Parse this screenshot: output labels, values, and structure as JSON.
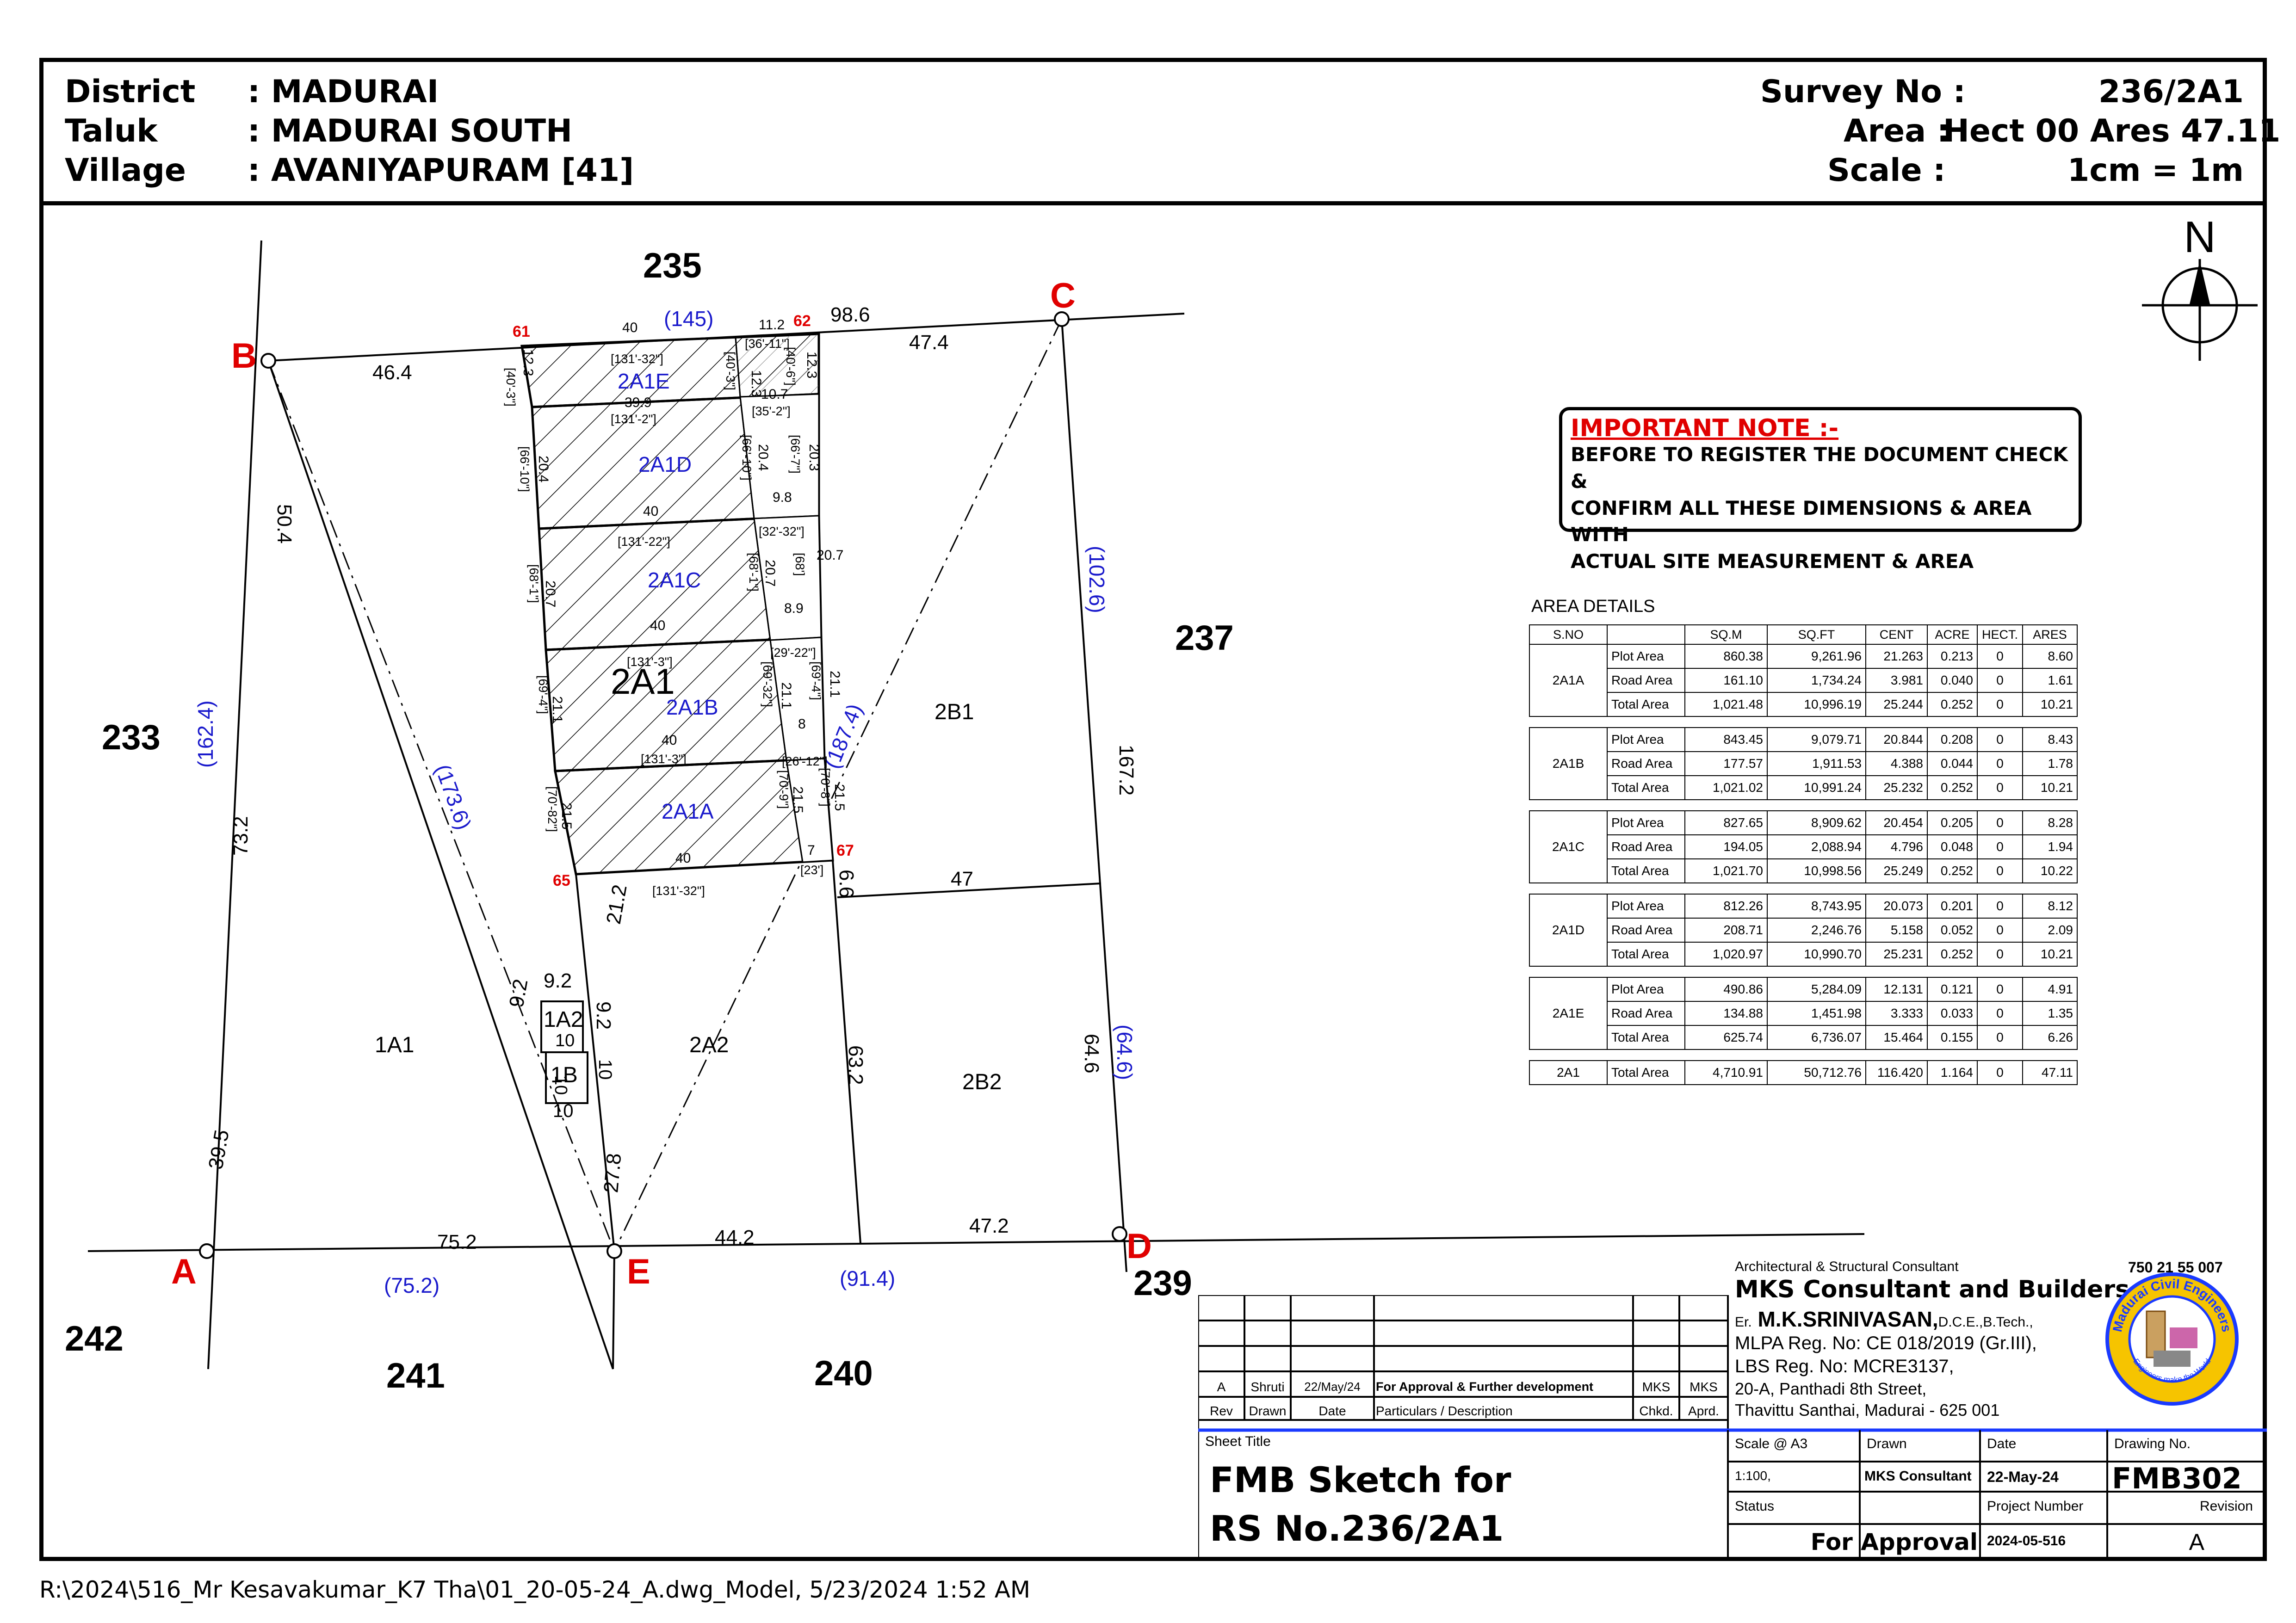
{
  "header": {
    "district_label": "District",
    "district_value": ": MADURAI",
    "taluk_label": "Taluk",
    "taluk_value": ": MADURAI SOUTH",
    "village_label": "Village",
    "village_value": ": AVANIYAPURAM  [41]",
    "survey_label": "Survey No :",
    "survey_value": "236/2A1",
    "area_label": "Area  :",
    "area_value": "Hect 00 Ares 47.11",
    "scale_label": "Scale :",
    "scale_value": "1cm = 1m"
  },
  "north": "N",
  "sketch": {
    "points": {
      "A": "A",
      "B": "B",
      "C": "C",
      "D": "D",
      "E": "E"
    },
    "survey_numbers": {
      "s235": "235",
      "s237": "237",
      "s233": "233",
      "s242": "242",
      "s241": "241",
      "s240": "240",
      "s239": "239"
    },
    "subdivisions": {
      "a1a1": "1A1",
      "a1a2": "1A2",
      "a1b": "1B",
      "a2a2": "2A2",
      "a2b1": "2B1",
      "a2b2": "2B2",
      "a2a1": "2A1"
    },
    "plots": {
      "p2a1a": "2A1A",
      "p2a1b": "2A1B",
      "p2a1c": "2A1C",
      "p2a1d": "2A1D",
      "p2a1e": "2A1E"
    },
    "red_points": {
      "r61": "61",
      "r62": "62",
      "r65": "65",
      "r67": "67"
    },
    "dims": {
      "d46_4": "46.4",
      "d40_top": "40",
      "d145": "(145)",
      "d11_2": "11.2",
      "d98_6": "98.6",
      "d47_4": "47.4",
      "d50_4": "50.4",
      "d162_4": "(162.4)",
      "d73_2": "73.2",
      "d173_6": "(173.6)",
      "d39_5": "39.5",
      "d102_6": "(102.6)",
      "d167_2": "167.2",
      "d64_6": "(64.6)",
      "d64_6b": "64.6",
      "d187_4": "(187.4)",
      "d75_2": "75.2",
      "d75_2b": "(75.2)",
      "d44_2": "44.2",
      "d47_2": "47.2",
      "d91_4": "(91.4)",
      "d21_2": "21.2",
      "d27_8": "27.8",
      "d63_2": "63.2",
      "d6_6": "6.6",
      "d47": "47",
      "d9_2a": "9.2",
      "d9_2b": "9.2",
      "d9_2c": "9.2",
      "d10a": "10",
      "d10b": "10",
      "d10c": "10",
      "d10d": "10",
      "d12_3a": "12.3",
      "d12_3b": "12.3",
      "d12_3c": "12.3",
      "d39_9": "39.9",
      "d10_7": "10.7",
      "d20_4a": "20.4",
      "d20_4b": "20.4",
      "d20_3": "20.3",
      "d9_8": "9.8",
      "d40_d": "40",
      "d20_7a": "20.7",
      "d20_7b": "20.7",
      "d20_7c": "20.7",
      "d8_9": "8.9",
      "d40_c": "40",
      "d21_1a": "21.1",
      "d21_1b": "21.1",
      "d21_1c": "21.1",
      "d8": "8",
      "d40_b": "40",
      "d21_5a": "21.5",
      "d21_5b": "21.5",
      "d21_5c": "21.5",
      "d7": "7",
      "d40_a": "40",
      "f131_32a": "[131'-32\"]",
      "f40_3a": "[40'-3\"]",
      "f40_3b": "[40'-3\"]",
      "f36_11": "[36'-11\"]",
      "f40_6": "[40'-6\"]",
      "f131_2": "[131'-2\"]",
      "f35_2": "[35'-2\"]",
      "f66_10a": "[66'-10\"]",
      "f66_10b": "[66'-10\"]",
      "f66_7": "[66'-7\"]",
      "f131_22": "[131'-22\"]",
      "f32_32": "[32'-32\"]",
      "f68_1a": "[68'-1\"]",
      "f68_1b": "[68'-1\"]",
      "f68": "[68']",
      "f131_3a": "[131'-3\"]",
      "f29_22": "[29'-22\"]",
      "f69_4a": "[69'-4\"]",
      "f69_32": "[69'-32\"]",
      "f69_4b": "[69'-4\"]",
      "f131_3b": "[131'-3\"]",
      "f26_12": "[26'-12\"]",
      "f70_82": "[70'-82\"]",
      "f70_9": "[70'-9\"]",
      "f70_8": "[70'-8\"]",
      "f131_32b": "[131'-32\"]",
      "f23": "[23']"
    }
  },
  "note": {
    "title": "IMPORTANT NOTE :-",
    "line1": "BEFORE TO REGISTER THE DOCUMENT CHECK &",
    "line2": "CONFIRM ALL THESE DIMENSIONS & AREA WITH",
    "line3": "ACTUAL SITE MEASUREMENT & AREA"
  },
  "area_details": {
    "title": "AREA DETAILS",
    "columns": [
      "S.NO",
      "",
      "SQ.M",
      "SQ.FT",
      "CENT",
      "ACRE",
      "HECT.",
      "ARES"
    ],
    "groups": [
      {
        "sno": "2A1A",
        "rows": [
          [
            "Plot Area",
            "860.38",
            "9,261.96",
            "21.263",
            "0.213",
            "0",
            "8.60"
          ],
          [
            "Road Area",
            "161.10",
            "1,734.24",
            "3.981",
            "0.040",
            "0",
            "1.61"
          ],
          [
            "Total Area",
            "1,021.48",
            "10,996.19",
            "25.244",
            "0.252",
            "0",
            "10.21"
          ]
        ]
      },
      {
        "sno": "2A1B",
        "rows": [
          [
            "Plot Area",
            "843.45",
            "9,079.71",
            "20.844",
            "0.208",
            "0",
            "8.43"
          ],
          [
            "Road Area",
            "177.57",
            "1,911.53",
            "4.388",
            "0.044",
            "0",
            "1.78"
          ],
          [
            "Total Area",
            "1,021.02",
            "10,991.24",
            "25.232",
            "0.252",
            "0",
            "10.21"
          ]
        ]
      },
      {
        "sno": "2A1C",
        "rows": [
          [
            "Plot Area",
            "827.65",
            "8,909.62",
            "20.454",
            "0.205",
            "0",
            "8.28"
          ],
          [
            "Road Area",
            "194.05",
            "2,088.94",
            "4.796",
            "0.048",
            "0",
            "1.94"
          ],
          [
            "Total Area",
            "1,021.70",
            "10,998.56",
            "25.249",
            "0.252",
            "0",
            "10.22"
          ]
        ]
      },
      {
        "sno": "2A1D",
        "rows": [
          [
            "Plot Area",
            "812.26",
            "8,743.95",
            "20.073",
            "0.201",
            "0",
            "8.12"
          ],
          [
            "Road Area",
            "208.71",
            "2,246.76",
            "5.158",
            "0.052",
            "0",
            "2.09"
          ],
          [
            "Total Area",
            "1,020.97",
            "10,990.70",
            "25.231",
            "0.252",
            "0",
            "10.21"
          ]
        ]
      },
      {
        "sno": "2A1E",
        "rows": [
          [
            "Plot Area",
            "490.86",
            "5,284.09",
            "12.131",
            "0.121",
            "0",
            "4.91"
          ],
          [
            "Road Area",
            "134.88",
            "1,451.98",
            "3.333",
            "0.033",
            "0",
            "1.35"
          ],
          [
            "Total Area",
            "625.74",
            "6,736.07",
            "15.464",
            "0.155",
            "0",
            "6.26"
          ]
        ]
      }
    ],
    "total": [
      "2A1",
      "Total Area",
      "4,710.91",
      "50,712.76",
      "116.420",
      "1.164",
      "0",
      "47.11"
    ]
  },
  "revision": {
    "row": [
      "A",
      "Shruti",
      "22/May/24",
      "For Approval & Further development",
      "MKS",
      "MKS"
    ],
    "headers": [
      "Rev",
      "Drawn",
      "Date",
      "Particulars / Description",
      "Chkd.",
      "Aprd."
    ]
  },
  "consultant": {
    "caption": "Architectural & Structural Consultant",
    "phone": "750 21 55 007",
    "name": "MKS Consultant and Builders,",
    "engineer_prefix": "Er.",
    "engineer": "M.K.SRINIVASAN,",
    "quals": "D.C.E.,B.Tech.,",
    "mlpa": "MLPA Reg. No: CE 018/2019 (Gr.III),",
    "lbs": "LBS Reg. No: MCRE3137,",
    "addr1": "20-A, Panthadi 8th Street,",
    "addr2": "Thavittu Santhai, Madurai - 625 001",
    "logo_text_top": "Madurai Civil Engineers",
    "logo_text_bottom": "Engineers make the World"
  },
  "sheet": {
    "title_label": "Sheet Title",
    "title_line1": "FMB Sketch for",
    "title_line2": "RS No.236/2A1",
    "scale_label": "Scale @ A3",
    "scale_value": "1:100,",
    "drawn_label": "Drawn",
    "drawn_value": "MKS Consultant",
    "date_label": "Date",
    "date_value": "22-May-24",
    "drawing_label": "Drawing No.",
    "drawing_value": "FMB302",
    "status_label": "Status",
    "status_value": "For Approval",
    "project_label": "Project Number",
    "project_value": "2024-05-516",
    "revision_label": "Revision",
    "revision_value": "A"
  },
  "footer_path": "R:\\2024\\516_Mr Kesavakumar_K7 Tha\\01_20-05-24_A.dwg_Model, 5/23/2024 1:52 AM"
}
